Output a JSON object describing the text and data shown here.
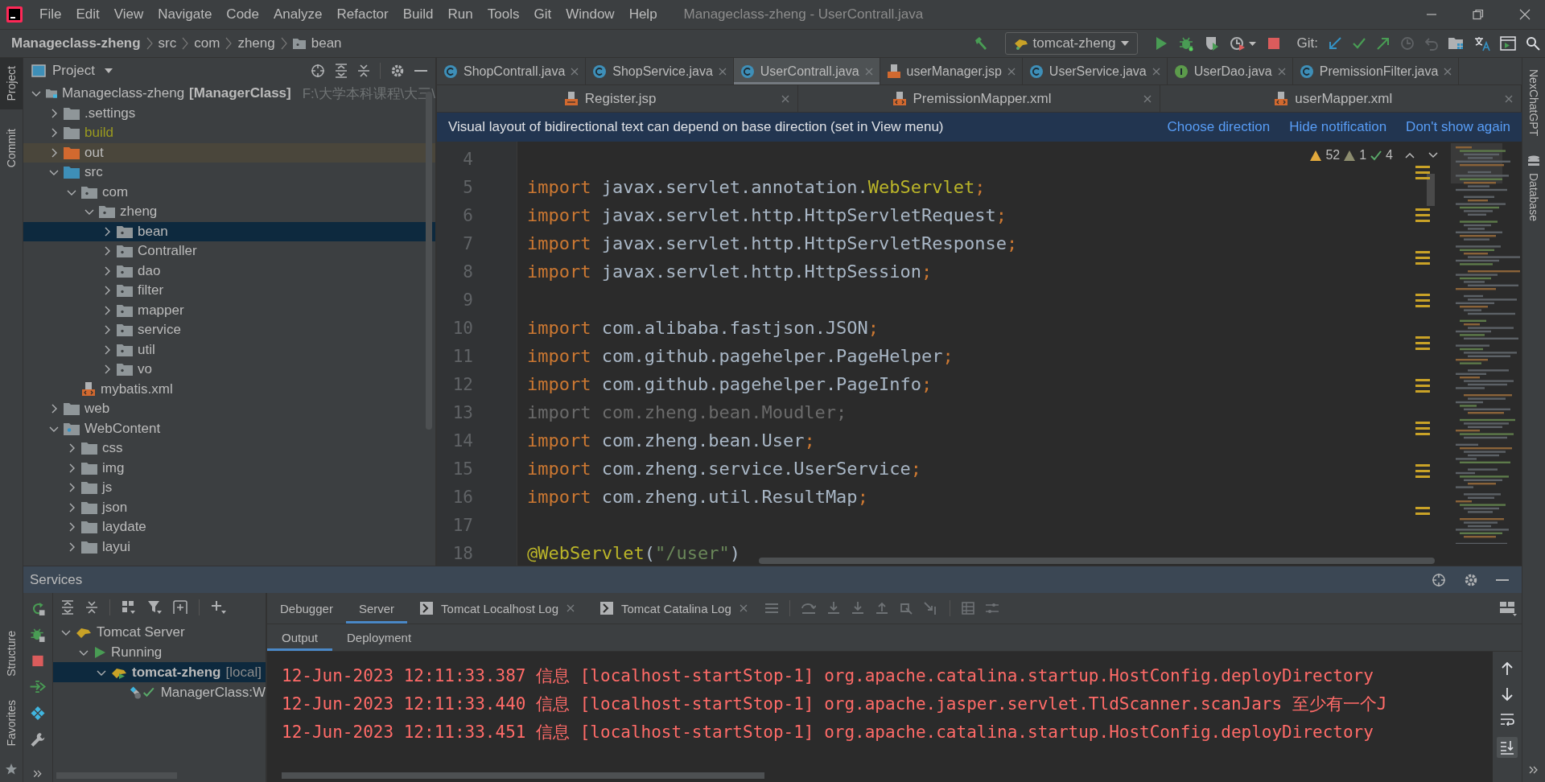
{
  "menu_bar": {
    "items": [
      "File",
      "Edit",
      "View",
      "Navigate",
      "Code",
      "Analyze",
      "Refactor",
      "Build",
      "Run",
      "Tools",
      "Git",
      "Window",
      "Help"
    ],
    "window_title": "Manageclass-zheng - UserContrall.java"
  },
  "breadcrumb": [
    {
      "label": "Manageclass-zheng",
      "kind": "project"
    },
    {
      "label": "src",
      "kind": "plain"
    },
    {
      "label": "com",
      "kind": "plain"
    },
    {
      "label": "zheng",
      "kind": "plain"
    },
    {
      "label": "bean",
      "kind": "package"
    }
  ],
  "toolbar": {
    "run_config": "tomcat-zheng",
    "git_label": "Git:"
  },
  "left_stripe": {
    "top": [
      {
        "label": "Project",
        "selected": true
      },
      {
        "label": "Commit",
        "selected": false
      }
    ],
    "bottom": [
      {
        "label": "Structure",
        "selected": false
      },
      {
        "label": "Favorites",
        "selected": false
      }
    ]
  },
  "project_panel": {
    "title": "Project",
    "tree": [
      {
        "label": "Manageclass-zheng",
        "module": "[ManagerClass]",
        "path": "F:\\大学本科课程\\大三\\",
        "kind": "module",
        "expanded": true,
        "selected": false,
        "children": [
          {
            "label": ".settings",
            "kind": "folder",
            "expanded": false,
            "selected": false
          },
          {
            "label": "build",
            "kind": "ignored-folder",
            "expanded": false,
            "selected": false
          },
          {
            "label": "out",
            "kind": "excluded-folder",
            "expanded": false,
            "selected": false
          },
          {
            "label": "src",
            "kind": "source-folder",
            "expanded": true,
            "selected": false,
            "children": [
              {
                "label": "com",
                "kind": "package",
                "expanded": true,
                "selected": false,
                "children": [
                  {
                    "label": "zheng",
                    "kind": "package",
                    "expanded": true,
                    "selected": false,
                    "children": [
                      {
                        "label": "bean",
                        "kind": "package",
                        "expanded": false,
                        "selected": true
                      },
                      {
                        "label": "Contraller",
                        "kind": "package",
                        "expanded": false,
                        "selected": false
                      },
                      {
                        "label": "dao",
                        "kind": "package",
                        "expanded": false,
                        "selected": false
                      },
                      {
                        "label": "filter",
                        "kind": "package",
                        "expanded": false,
                        "selected": false
                      },
                      {
                        "label": "mapper",
                        "kind": "package",
                        "expanded": false,
                        "selected": false
                      },
                      {
                        "label": "service",
                        "kind": "package",
                        "expanded": false,
                        "selected": false
                      },
                      {
                        "label": "util",
                        "kind": "package",
                        "expanded": false,
                        "selected": false
                      },
                      {
                        "label": "vo",
                        "kind": "package",
                        "expanded": false,
                        "selected": false
                      }
                    ]
                  }
                ]
              },
              {
                "label": "mybatis.xml",
                "kind": "xml-file",
                "selected": false
              }
            ]
          },
          {
            "label": "web",
            "kind": "folder",
            "expanded": false,
            "selected": false
          },
          {
            "label": "WebContent",
            "kind": "web-folder",
            "expanded": true,
            "selected": false,
            "children": [
              {
                "label": "css",
                "kind": "folder",
                "expanded": false,
                "selected": false
              },
              {
                "label": "img",
                "kind": "folder",
                "expanded": false,
                "selected": false
              },
              {
                "label": "js",
                "kind": "folder",
                "expanded": false,
                "selected": false
              },
              {
                "label": "json",
                "kind": "folder",
                "expanded": false,
                "selected": false
              },
              {
                "label": "laydate",
                "kind": "folder",
                "expanded": false,
                "selected": false
              },
              {
                "label": "layui",
                "kind": "folder",
                "expanded": false,
                "selected": false
              }
            ]
          }
        ]
      }
    ]
  },
  "editor": {
    "tabs": [
      {
        "label": "ShopContrall.java",
        "kind": "class",
        "selected": false
      },
      {
        "label": "ShopService.java",
        "kind": "class",
        "selected": false
      },
      {
        "label": "UserContrall.java",
        "kind": "class",
        "selected": true
      },
      {
        "label": "userManager.jsp",
        "kind": "jsp",
        "selected": false
      },
      {
        "label": "UserService.java",
        "kind": "class",
        "selected": false
      },
      {
        "label": "UserDao.java",
        "kind": "interface",
        "selected": false
      },
      {
        "label": "PremissionFilter.java",
        "kind": "class",
        "selected": false
      }
    ],
    "tabs_row2": [
      {
        "label": "Register.jsp",
        "kind": "jsp",
        "selected": false
      },
      {
        "label": "PremissionMapper.xml",
        "kind": "xml",
        "selected": false
      },
      {
        "label": "userMapper.xml",
        "kind": "xml",
        "selected": false
      }
    ],
    "notification": {
      "text": "Visual layout of bidirectional text can depend on base direction (set in View menu)",
      "links": [
        "Choose direction",
        "Hide notification",
        "Don't show again"
      ]
    },
    "inspections": {
      "warnings": "52",
      "weak_warnings": "1",
      "typos": "4"
    },
    "lines": [
      {
        "number": "4"
      },
      {
        "number": "5",
        "tokens": [
          {
            "text": "import",
            "kind": "keyword"
          },
          {
            "text": " javax.servlet.annotation.",
            "kind": "plain"
          },
          {
            "text": "WebServlet",
            "kind": "annotation"
          },
          {
            "text": ";",
            "kind": "keyword"
          }
        ]
      },
      {
        "number": "6",
        "tokens": [
          {
            "text": "import",
            "kind": "keyword"
          },
          {
            "text": " javax.servlet.http.HttpServletRequest",
            "kind": "plain"
          },
          {
            "text": ";",
            "kind": "keyword"
          }
        ]
      },
      {
        "number": "7",
        "tokens": [
          {
            "text": "import",
            "kind": "keyword"
          },
          {
            "text": " javax.servlet.http.HttpServletResponse",
            "kind": "plain"
          },
          {
            "text": ";",
            "kind": "keyword"
          }
        ]
      },
      {
        "number": "8",
        "tokens": [
          {
            "text": "import",
            "kind": "keyword"
          },
          {
            "text": " javax.servlet.http.HttpSession",
            "kind": "plain"
          },
          {
            "text": ";",
            "kind": "keyword"
          }
        ]
      },
      {
        "number": "9"
      },
      {
        "number": "10",
        "tokens": [
          {
            "text": "import",
            "kind": "keyword"
          },
          {
            "text": " com.alibaba.fastjson.JSON",
            "kind": "plain"
          },
          {
            "text": ";",
            "kind": "keyword"
          }
        ]
      },
      {
        "number": "11",
        "tokens": [
          {
            "text": "import",
            "kind": "keyword"
          },
          {
            "text": " com.github.pagehelper.PageHelper",
            "kind": "plain"
          },
          {
            "text": ";",
            "kind": "keyword"
          }
        ]
      },
      {
        "number": "12",
        "tokens": [
          {
            "text": "import",
            "kind": "keyword"
          },
          {
            "text": " com.github.pagehelper.PageInfo",
            "kind": "plain"
          },
          {
            "text": ";",
            "kind": "keyword"
          }
        ]
      },
      {
        "number": "13",
        "tokens": [
          {
            "text": "import com.zheng.bean.Moudler;",
            "kind": "unused"
          }
        ]
      },
      {
        "number": "14",
        "tokens": [
          {
            "text": "import",
            "kind": "keyword"
          },
          {
            "text": " com.zheng.bean.User",
            "kind": "plain"
          },
          {
            "text": ";",
            "kind": "keyword"
          }
        ]
      },
      {
        "number": "15",
        "tokens": [
          {
            "text": "import",
            "kind": "keyword"
          },
          {
            "text": " com.zheng.service.UserService",
            "kind": "plain"
          },
          {
            "text": ";",
            "kind": "keyword"
          }
        ]
      },
      {
        "number": "16",
        "tokens": [
          {
            "text": "import",
            "kind": "keyword"
          },
          {
            "text": " com.zheng.util.ResultMap",
            "kind": "plain"
          },
          {
            "text": ";",
            "kind": "keyword"
          }
        ]
      },
      {
        "number": "17"
      },
      {
        "number": "18",
        "tokens": [
          {
            "text": "@WebServlet",
            "kind": "annotation"
          },
          {
            "text": "(",
            "kind": "plain"
          },
          {
            "text": "\"/user\"",
            "kind": "string"
          },
          {
            "text": ")",
            "kind": "plain"
          }
        ]
      }
    ]
  },
  "right_stripe": [
    {
      "label": "NexChatGPT",
      "selected": false
    },
    {
      "label": "Database",
      "selected": false
    }
  ],
  "services": {
    "title": "Services",
    "tree": [
      {
        "label": "Tomcat Server",
        "kind": "server",
        "expanded": true,
        "selected": false,
        "children": [
          {
            "label": "Running",
            "kind": "running",
            "expanded": true,
            "selected": false,
            "children": [
              {
                "label": "tomcat-zheng",
                "suffix": "[local]",
                "kind": "instance",
                "expanded": true,
                "selected": true,
                "children": [
                  {
                    "label": "ManagerClass:W",
                    "kind": "artifact",
                    "selected": false
                  }
                ]
              }
            ]
          }
        ]
      }
    ],
    "tabs": [
      {
        "label": "Debugger",
        "kind": "plain",
        "selected": false
      },
      {
        "label": "Server",
        "kind": "plain",
        "selected": true
      },
      {
        "label": "Tomcat Localhost Log",
        "kind": "log",
        "selected": false
      },
      {
        "label": "Tomcat Catalina Log",
        "kind": "log",
        "selected": false
      }
    ],
    "subtabs": [
      {
        "label": "Output",
        "selected": true
      },
      {
        "label": "Deployment",
        "selected": false
      }
    ],
    "console": [
      "12-Jun-2023 12:11:33.387 信息 [localhost-startStop-1] org.apache.catalina.startup.HostConfig.deployDirectory",
      "12-Jun-2023 12:11:33.440 信息 [localhost-startStop-1] org.apache.jasper.servlet.TldScanner.scanJars 至少有一个J",
      "12-Jun-2023 12:11:33.451 信息 [localhost-startStop-1] org.apache.catalina.startup.HostConfig.deployDirectory"
    ]
  }
}
